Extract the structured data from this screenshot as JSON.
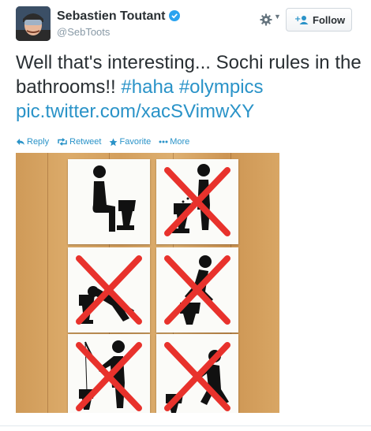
{
  "user": {
    "display_name": "Sebastien Toutant",
    "handle": "@SebToots",
    "verified": true,
    "avatar_icon": "avatar-photo"
  },
  "header": {
    "more_menu_icon": "gear-icon",
    "follow_label": "Follow"
  },
  "tweet": {
    "text_plain": "Well that's interesting... Sochi rules in the bathrooms!!",
    "hashtags": [
      "#haha",
      "#olympics"
    ],
    "link": "pic.twitter.com/xacSVimwXY"
  },
  "actions": [
    {
      "label": "Reply",
      "icon": "reply-icon"
    },
    {
      "label": "Retweet",
      "icon": "retweet-icon"
    },
    {
      "label": "Favorite",
      "icon": "star-icon"
    },
    {
      "label": "More",
      "icon": "more-dots-icon"
    }
  ],
  "photo": {
    "signs": [
      {
        "pictogram": "sit-on-toilet",
        "crossed": false
      },
      {
        "pictogram": "stand-on-toilet",
        "crossed": true
      },
      {
        "pictogram": "drink-from-toilet",
        "crossed": true
      },
      {
        "pictogram": "squat-on-toilet",
        "crossed": true
      },
      {
        "pictogram": "fish-in-toilet",
        "crossed": true
      },
      {
        "pictogram": "clean-toilet-from-floor",
        "crossed": true
      }
    ]
  },
  "colors": {
    "link": "#2a93c8",
    "text": "#292f33",
    "secondary": "#8899a6",
    "verified": "#2aa3ef",
    "cross": "#e8322c"
  }
}
